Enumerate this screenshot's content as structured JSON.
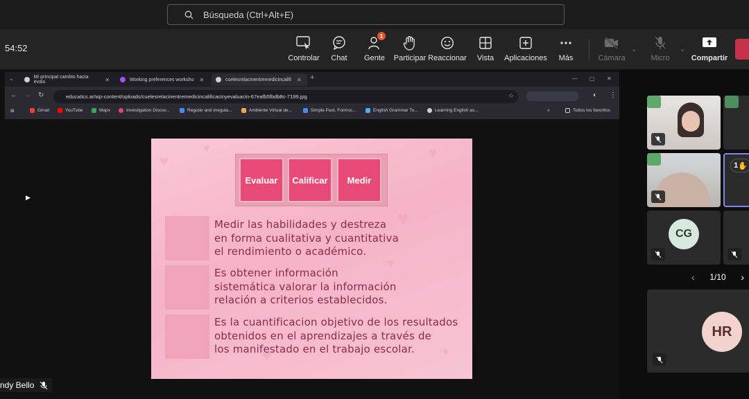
{
  "search": {
    "placeholder": "Búsqueda (Ctrl+Alt+E)"
  },
  "meeting": {
    "timer": "54:52",
    "controls": [
      {
        "label": "Controlar",
        "icon": "control-icon"
      },
      {
        "label": "Chat",
        "icon": "chat-icon"
      },
      {
        "label": "Gente",
        "icon": "people-icon",
        "badge": "1"
      },
      {
        "label": "Participar",
        "icon": "hand-icon"
      },
      {
        "label": "Reaccionar",
        "icon": "smile-icon"
      },
      {
        "label": "Vista",
        "icon": "grid-icon"
      },
      {
        "label": "Aplicaciones",
        "icon": "plus-square-icon"
      },
      {
        "label": "Más",
        "icon": "more-icon"
      },
      {
        "label": "Cámara",
        "icon": "camera-off-icon"
      },
      {
        "label": "Micro",
        "icon": "mic-off-icon"
      },
      {
        "label": "Compartir",
        "icon": "share-icon"
      }
    ]
  },
  "browser": {
    "tabs": [
      {
        "title": "Mi principal cambio hacia evalu"
      },
      {
        "title": "Working preferences worksho"
      },
      {
        "title": "cuelesrelacinentremedicincalifi"
      }
    ],
    "url": "educatics.ar/wp-content/uploads/cuelesrelacinentremedicincalificacinyevaluacin-67eafb5fbdb8c-7199.jpg",
    "bookmarks": [
      "Gmail",
      "YouTube",
      "Maps",
      "Investigation Discov...",
      "Regular and irregula...",
      "Ambiente Virtual de...",
      "Simple Past. Formsc...",
      "English Grammar To...",
      "Learning English as..."
    ],
    "favorites": "Todos los favoritos"
  },
  "slide": {
    "keys": [
      "Evaluar",
      "Calificar",
      "Medir"
    ],
    "paragraphs": [
      [
        "Medir las habilidades y destreza",
        "en forma cualitativa y cuantitativa",
        "el rendimiento o académico."
      ],
      [
        "Es obtener información",
        "sistemática valorar la información",
        "relación a criterios establecidos."
      ],
      [
        "Es la cuantificacion objetivo de los resultados",
        "obtenidos en el aprendizajes a través de",
        "los manifestado en el trabajo escolar."
      ]
    ]
  },
  "presenter": {
    "name": "ndy Bello"
  },
  "participants": {
    "initials_1": "CG",
    "initials_2": "HR",
    "raised_hand_count": "1",
    "page": "1/10"
  }
}
